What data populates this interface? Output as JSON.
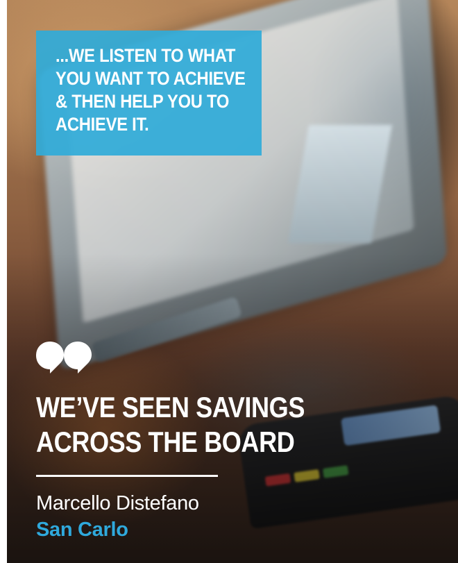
{
  "callout": {
    "lines": [
      "...WE LISTEN TO WHAT",
      "YOU WANT TO ACHIEVE",
      "& THEN HELP YOU TO",
      "ACHIEVE IT."
    ]
  },
  "testimonial": {
    "quote_icon": "quote-icon",
    "headline_lines": [
      "WE’VE SEEN SAVINGS",
      "ACROSS THE BOARD"
    ],
    "author": "Marcello Distefano",
    "company": "San Carlo"
  },
  "colors": {
    "callout_bg": "#30abd8",
    "company_text": "#2fa9dc",
    "headline_text": "#ffffff"
  }
}
